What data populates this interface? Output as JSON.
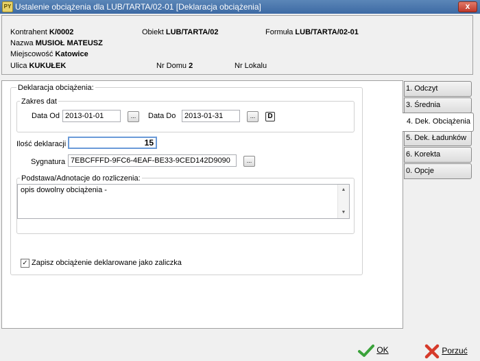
{
  "window": {
    "title": "Ustalenie obciążenia dla LUB/TARTA/02-01   [Deklaracja obciążenia]",
    "app_icon": "PY",
    "close": "x"
  },
  "info": {
    "kontrahent_label": "Kontrahent",
    "kontrahent_value": "K/0002",
    "obiekt_label": "Obiekt",
    "obiekt_value": "LUB/TARTA/02",
    "formula_label": "Formuła",
    "formula_value": "LUB/TARTA/02-01",
    "nazwa_label": "Nazwa",
    "nazwa_value": "MUSIOŁ MATEUSZ",
    "miejscowosc_label": "Miejscowość",
    "miejscowosc_value": "Katowice",
    "ulica_label": "Ulica",
    "ulica_value": "KUKUŁEK",
    "nr_domu_label": "Nr Domu",
    "nr_domu_value": "2",
    "nr_lokalu_label": "Nr Lokalu",
    "nr_lokalu_value": ""
  },
  "form": {
    "group_title": "Deklaracja obciążenia:",
    "zakres_title": "Zakres dat",
    "data_od_label": "Data Od",
    "data_od_value": "2013-01-01",
    "data_do_label": "Data Do",
    "data_do_value": "2013-01-31",
    "dots": "...",
    "d_button": "D",
    "ilosc_label": "Ilość deklaracji",
    "ilosc_value": "15",
    "sygnatura_label": "Sygnatura",
    "sygnatura_value": "7EBCFFFD-9FC6-4EAF-BE33-9CED142D9090",
    "podstawa_title": "Podstawa/Adnotacje do rozliczenia:",
    "podstawa_text": "opis dowolny obciążenia -",
    "zapisz_label": "Zapisz obciążenie deklarowane jako zaliczka",
    "zapisz_checked": true
  },
  "tabs": [
    {
      "label": "1. Odczyt",
      "active": false
    },
    {
      "label": "3. Średnia",
      "active": false
    },
    {
      "label": "4. Dek. Obciążenia",
      "active": true
    },
    {
      "label": "5. Dek. Ładunków",
      "active": false
    },
    {
      "label": "6. Korekta",
      "active": false
    },
    {
      "label": "0. Opcje",
      "active": false
    }
  ],
  "buttons": {
    "ok_label": "OK",
    "porzuc_label": "Porzuć"
  },
  "colors": {
    "ok_icon": "#3aa23a",
    "porzuc_icon": "#d63a2a"
  },
  "icons": {
    "ok": "check-icon",
    "porzuc": "cross-icon",
    "scroll_up": "scroll-up-arrow-icon",
    "scroll_down": "scroll-down-arrow-icon"
  }
}
